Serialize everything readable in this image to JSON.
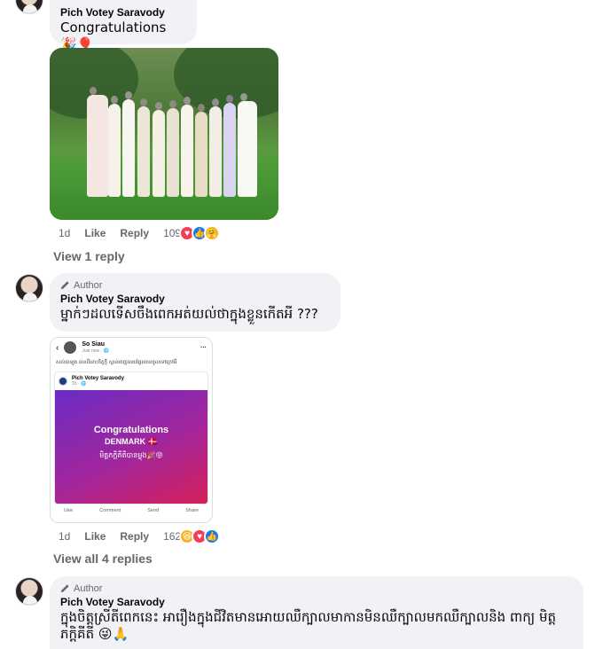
{
  "comments": [
    {
      "name": "Pich Votey Saravody",
      "text": "Congratulations 🎉🎈",
      "time": "1d",
      "like_label": "Like",
      "reply_label": "Reply",
      "reaction_count": "109",
      "reactions": [
        "heart",
        "like",
        "care"
      ],
      "view_replies": "View 1 reply"
    },
    {
      "author_badge": "Author",
      "name": "Pich Votey Saravody",
      "text": "ម្នាក់ៗដលទើសចឹងពេកអត់យល់ថាក្នុងខ្លួនកើតអី ???",
      "time": "1d",
      "like_label": "Like",
      "reply_label": "Reply",
      "reaction_count": "162",
      "reactions": [
        "haha",
        "heart",
        "like"
      ],
      "view_replies": "View all 4 replies",
      "screenshot": {
        "poster_name": "So Siau",
        "poster_time": "Just now · 🌐",
        "post_text": "សល់បាឡុង បានពីនោះចិត្តក្ដី ស្ទាន់ចេញបាយផ្ទៃឈានចូលទៅក្រៅអី",
        "card_name": "Pich Votey Saravody",
        "card_time": "1h · 🌐",
        "line1": "Congratulations",
        "line2": "DENMARK 🇩🇰",
        "line3": "មិត្តភក្តិគីតីបានម្លុង🎉😝",
        "bar": [
          "Like",
          "Comment",
          "Send",
          "Share"
        ]
      }
    },
    {
      "author_badge": "Author",
      "name": "Pich Votey Saravody",
      "text": "ក្នុងចិត្តស្រីតីពេកនេះ អារឿងក្នុងជីវិតមានអោយឈឺក្បាលមាកានមិនឈឺក្បាលមកឈឺក្បាលនិង ពាក្យ មិត្តភក្តិគីតី 😜🙏"
    }
  ],
  "colors": {
    "bubble": "#f0f2f5",
    "meta_text": "#65676b",
    "like_blue": "#1877f2",
    "heart_red": "#f33e58",
    "haha_yellow": "#f7b125"
  }
}
